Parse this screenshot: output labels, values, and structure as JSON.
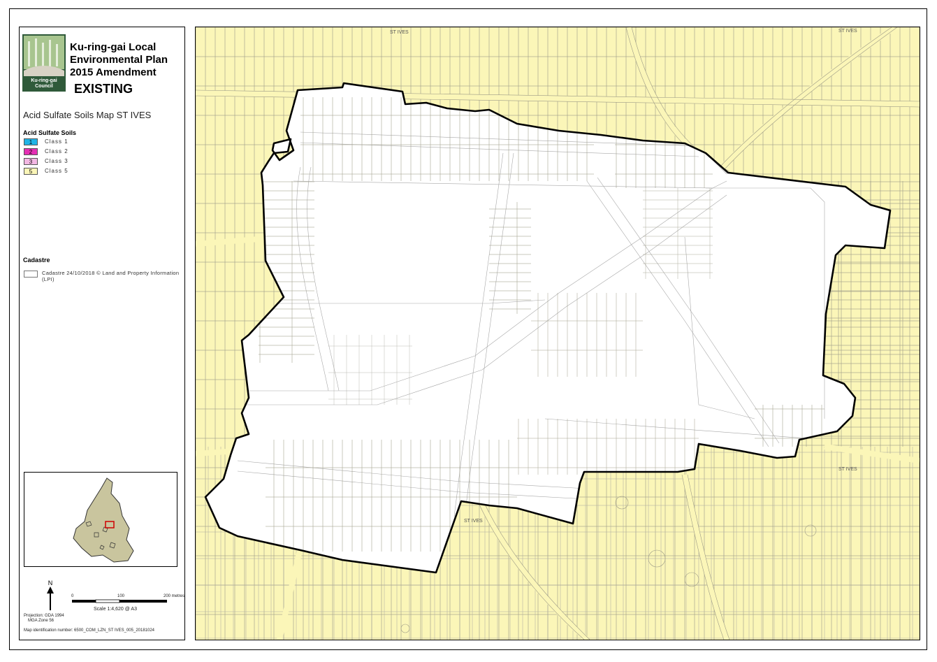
{
  "legend": {
    "title_line1": "Ku-ring-gai Local",
    "title_line2": "Environmental Plan",
    "title_line3": "2015 Amendment",
    "status": "EXISTING",
    "map_title": "Acid Sulfate Soils Map ST IVES",
    "logo_text1": "Ku-ring-gai",
    "logo_text2": "Council",
    "asz_heading": "Acid Sulfate Soils",
    "classes": [
      {
        "code": "1",
        "label": "Class 1",
        "color": "#1fb4e6"
      },
      {
        "code": "2",
        "label": "Class 2",
        "color": "#e52fb4"
      },
      {
        "code": "3",
        "label": "Class 3",
        "color": "#f3b7e3"
      },
      {
        "code": "5",
        "label": "Class 5",
        "color": "#fbf6b8"
      }
    ],
    "cadastre_heading": "Cadastre",
    "cadastre_text": "Cadastre 24/10/2018 © Land and Property Information (LPI)",
    "north": "N",
    "scale_ticks": [
      "0",
      "100",
      "200 metres"
    ],
    "scale_text": "Scale 1:4,620 @ A3",
    "projection_line1": "Projection: GDA 1994",
    "projection_line2": "MGA Zone 56",
    "map_id": "Map identification number: 6500_COM_LZN_ST IVES_005_20181024"
  },
  "map": {
    "labels": [
      "ST IVES",
      "ST IVES",
      "ST IVES",
      "ST IVES"
    ]
  }
}
